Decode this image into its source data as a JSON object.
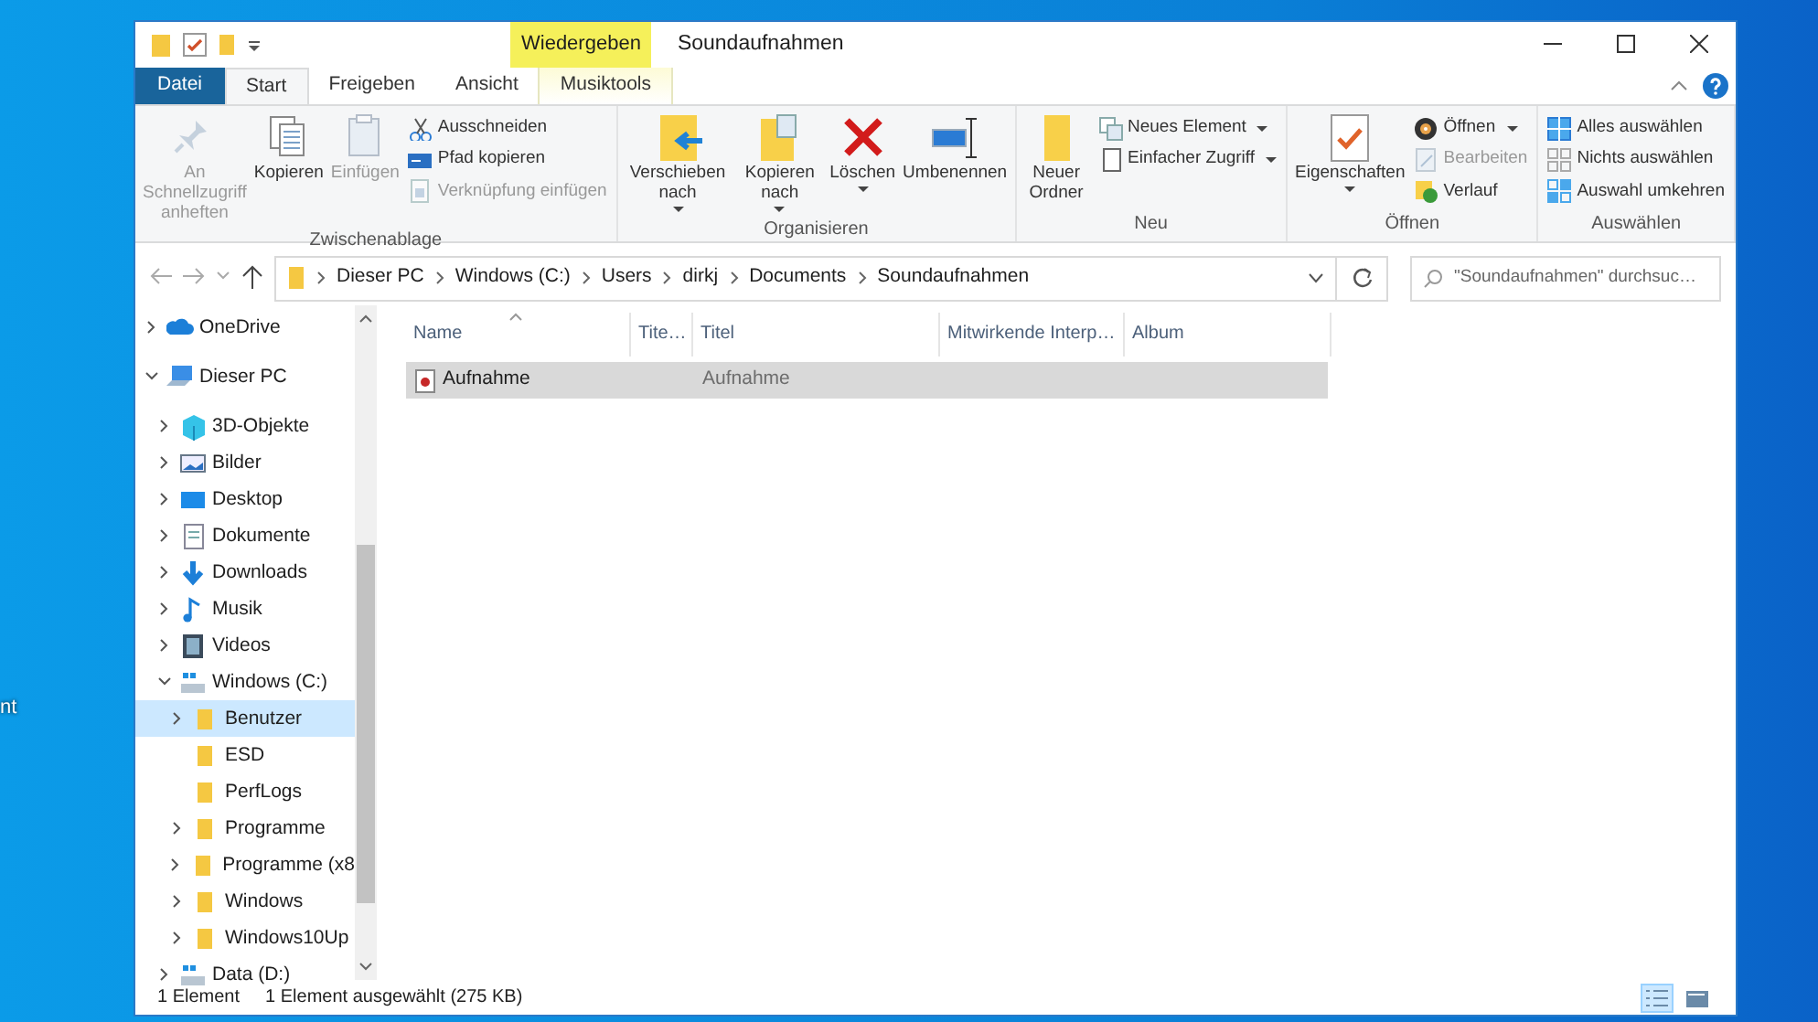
{
  "desktop": {
    "label_fragment": "nt"
  },
  "window": {
    "title": "Soundaufnahmen",
    "context_tab_header": "Wiedergeben"
  },
  "tabs": [
    {
      "label": "Datei",
      "kind": "file",
      "selected": false
    },
    {
      "label": "Start",
      "kind": "tab",
      "selected": true
    },
    {
      "label": "Freigeben",
      "kind": "tab",
      "selected": false
    },
    {
      "label": "Ansicht",
      "kind": "tab",
      "selected": false
    },
    {
      "label": "Musiktools",
      "kind": "tab",
      "selected": false
    }
  ],
  "ribbon": [
    {
      "name": "Zwischenablage",
      "items": [
        {
          "kind": "large",
          "label": "An Schnellzugriff anheften",
          "disabled": true,
          "dropdown": false
        },
        {
          "kind": "large",
          "label": "Kopieren",
          "disabled": false,
          "dropdown": false
        },
        {
          "kind": "large",
          "label": "Einfügen",
          "disabled": true,
          "dropdown": false
        },
        {
          "kind": "small",
          "label": "Ausschneiden",
          "disabled": false,
          "dropdown": false
        },
        {
          "kind": "small",
          "label": "Pfad kopieren",
          "disabled": false,
          "dropdown": false
        },
        {
          "kind": "small",
          "label": "Verknüpfung einfügen",
          "disabled": true,
          "dropdown": false
        }
      ]
    },
    {
      "name": "Organisieren",
      "items": [
        {
          "kind": "large",
          "label": "Verschieben nach",
          "disabled": false,
          "dropdown": true
        },
        {
          "kind": "large",
          "label": "Kopieren nach",
          "disabled": false,
          "dropdown": true
        },
        {
          "kind": "large",
          "label": "Löschen",
          "disabled": false,
          "dropdown": true
        },
        {
          "kind": "large",
          "label": "Umbenennen",
          "disabled": false,
          "dropdown": false
        }
      ]
    },
    {
      "name": "Neu",
      "items": [
        {
          "kind": "large",
          "label": "Neuer Ordner",
          "disabled": false,
          "dropdown": false
        },
        {
          "kind": "small",
          "label": "Neues Element",
          "disabled": false,
          "dropdown": true
        },
        {
          "kind": "small",
          "label": "Einfacher Zugriff",
          "disabled": false,
          "dropdown": true
        }
      ]
    },
    {
      "name": "Öffnen",
      "items": [
        {
          "kind": "large",
          "label": "Eigenschaften",
          "disabled": false,
          "dropdown": true
        },
        {
          "kind": "small",
          "label": "Öffnen",
          "disabled": false,
          "dropdown": true
        },
        {
          "kind": "small",
          "label": "Bearbeiten",
          "disabled": true,
          "dropdown": false
        },
        {
          "kind": "small",
          "label": "Verlauf",
          "disabled": false,
          "dropdown": false
        }
      ]
    },
    {
      "name": "Auswählen",
      "items": [
        {
          "kind": "small",
          "label": "Alles auswählen",
          "disabled": false,
          "dropdown": false
        },
        {
          "kind": "small",
          "label": "Nichts auswählen",
          "disabled": false,
          "dropdown": false
        },
        {
          "kind": "small",
          "label": "Auswahl umkehren",
          "disabled": false,
          "dropdown": false
        }
      ]
    }
  ],
  "address": {
    "breadcrumbs": [
      "Dieser PC",
      "Windows (C:)",
      "Users",
      "dirkj",
      "Documents",
      "Soundaufnahmen"
    ]
  },
  "search": {
    "placeholder": "\"Soundaufnahmen\" durchsuc…"
  },
  "sidebar": {
    "items": [
      {
        "label": "OneDrive",
        "kind": "cloud",
        "expanded": false,
        "selected": false
      },
      {
        "label": "Dieser PC",
        "kind": "pc",
        "expanded": true,
        "selected": false,
        "children": [
          {
            "label": "3D-Objekte",
            "kind": "cube",
            "expanded": false,
            "selected": false
          },
          {
            "label": "Bilder",
            "kind": "pictures",
            "expanded": false,
            "selected": false
          },
          {
            "label": "Desktop",
            "kind": "desktop",
            "expanded": false,
            "selected": false
          },
          {
            "label": "Dokumente",
            "kind": "document",
            "expanded": false,
            "selected": false
          },
          {
            "label": "Downloads",
            "kind": "download",
            "expanded": false,
            "selected": false
          },
          {
            "label": "Musik",
            "kind": "music",
            "expanded": false,
            "selected": false
          },
          {
            "label": "Videos",
            "kind": "video",
            "expanded": false,
            "selected": false
          },
          {
            "label": "Windows (C:)",
            "kind": "drive",
            "expanded": true,
            "selected": false,
            "children": [
              {
                "label": "Benutzer",
                "kind": "folder",
                "expanded": false,
                "selected": true
              },
              {
                "label": "ESD",
                "kind": "folder",
                "selected": false
              },
              {
                "label": "PerfLogs",
                "kind": "folder",
                "selected": false
              },
              {
                "label": "Programme",
                "kind": "folder",
                "expanded": false,
                "selected": false
              },
              {
                "label": "Programme (x8",
                "kind": "folder",
                "expanded": false,
                "selected": false
              },
              {
                "label": "Windows",
                "kind": "folder",
                "expanded": false,
                "selected": false
              },
              {
                "label": "Windows10Up",
                "kind": "folder",
                "expanded": false,
                "selected": false
              }
            ]
          },
          {
            "label": "Data (D:)",
            "kind": "drive",
            "expanded": false,
            "selected": false
          }
        ]
      }
    ]
  },
  "table": {
    "columns": [
      {
        "label": "Name",
        "sorted": true
      },
      {
        "label": "Tite…",
        "sorted": false
      },
      {
        "label": "Titel",
        "sorted": false
      },
      {
        "label": "Mitwirkende Interp…",
        "sorted": false
      },
      {
        "label": "Album",
        "sorted": false
      }
    ],
    "rows": [
      {
        "name": "Aufnahme",
        "column_3": "Aufnahme",
        "selected": true
      }
    ]
  },
  "status_bar": {
    "item_count": "1 Element",
    "selection": "1 Element ausgewählt (275 KB)"
  },
  "views": [
    {
      "kind": "details",
      "selected": true
    },
    {
      "kind": "tiles",
      "selected": false
    }
  ]
}
